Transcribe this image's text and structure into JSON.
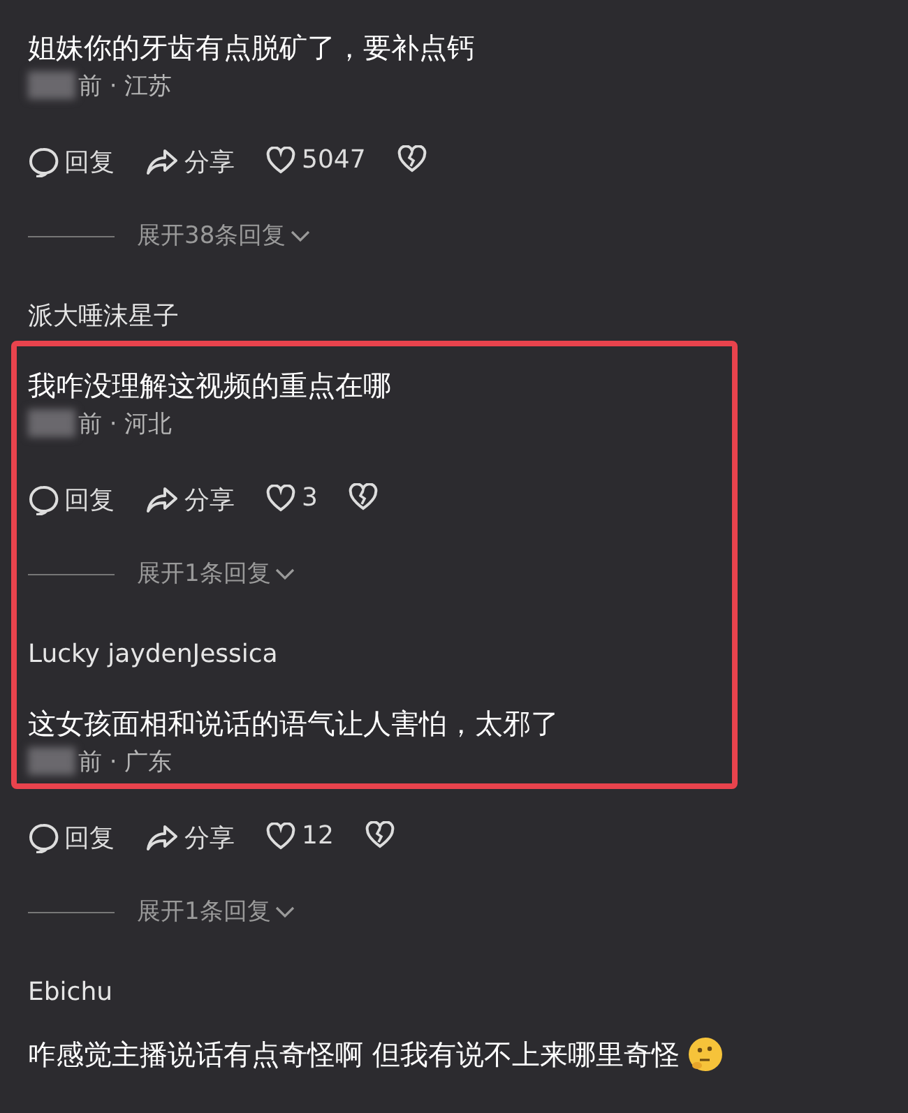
{
  "comments": [
    {
      "text": "姐妹你的牙齿有点脱矿了，要补点钙",
      "meta": "前 · 江苏",
      "reply": "回复",
      "share": "分享",
      "likes": "5047",
      "expand": "展开38条回复",
      "highlighted": false
    },
    {
      "author": "派大唾沫星子",
      "text": "我咋没理解这视频的重点在哪",
      "meta": "前 · 河北",
      "reply": "回复",
      "share": "分享",
      "likes": "3",
      "expand": "展开1条回复",
      "highlighted": true
    },
    {
      "author": "Lucky jaydenJessica",
      "text": "这女孩面相和说话的语气让人害怕，太邪了",
      "meta": "前 · 广东",
      "reply": "回复",
      "share": "分享",
      "likes": "12",
      "expand": "展开1条回复",
      "highlighted": true
    },
    {
      "author": "Ebichu",
      "text": "咋感觉主播说话有点奇怪啊 但我有说不上来哪里奇怪",
      "emoji": true,
      "highlighted": false
    }
  ]
}
